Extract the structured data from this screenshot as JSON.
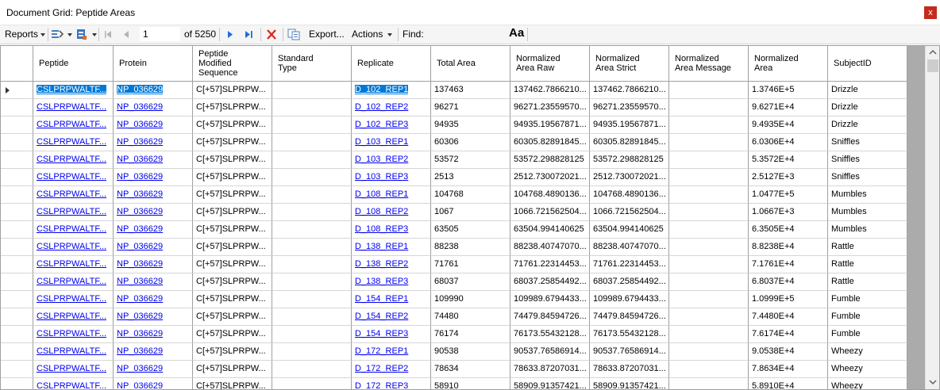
{
  "window": {
    "title": "Document Grid: Peptide Areas",
    "close_glyph": "x"
  },
  "toolbar": {
    "reports_label": "Reports",
    "position_value": "1",
    "of_label": "of 5250",
    "export_label": "Export...",
    "actions_label": "Actions",
    "find_label": "Find:",
    "find_value": "",
    "font_icon": "Aa"
  },
  "columns": [
    "Peptide",
    "Protein",
    "Peptide\nModified\nSequence",
    "Standard\nType",
    "Replicate",
    "Total Area",
    "Normalized\nArea Raw",
    "Normalized\nArea Strict",
    "Normalized\nArea Message",
    "Normalized\nArea",
    "SubjectID"
  ],
  "rows": [
    [
      "CSLPRPWALTF...",
      "NP_036629",
      "C[+57]SLPRPW...",
      "",
      "D_102_REP1",
      "137463",
      "137462.7866210...",
      "137462.7866210...",
      "",
      "1.3746E+5",
      "Drizzle"
    ],
    [
      "CSLPRPWALTF...",
      "NP_036629",
      "C[+57]SLPRPW...",
      "",
      "D_102_REP2",
      "96271",
      "96271.23559570...",
      "96271.23559570...",
      "",
      "9.6271E+4",
      "Drizzle"
    ],
    [
      "CSLPRPWALTF...",
      "NP_036629",
      "C[+57]SLPRPW...",
      "",
      "D_102_REP3",
      "94935",
      "94935.19567871...",
      "94935.19567871...",
      "",
      "9.4935E+4",
      "Drizzle"
    ],
    [
      "CSLPRPWALTF...",
      "NP_036629",
      "C[+57]SLPRPW...",
      "",
      "D_103_REP1",
      "60306",
      "60305.82891845...",
      "60305.82891845...",
      "",
      "6.0306E+4",
      "Sniffles"
    ],
    [
      "CSLPRPWALTF...",
      "NP_036629",
      "C[+57]SLPRPW...",
      "",
      "D_103_REP2",
      "53572",
      "53572.298828125",
      "53572.298828125",
      "",
      "5.3572E+4",
      "Sniffles"
    ],
    [
      "CSLPRPWALTF...",
      "NP_036629",
      "C[+57]SLPRPW...",
      "",
      "D_103_REP3",
      "2513",
      "2512.730072021...",
      "2512.730072021...",
      "",
      "2.5127E+3",
      "Sniffles"
    ],
    [
      "CSLPRPWALTF...",
      "NP_036629",
      "C[+57]SLPRPW...",
      "",
      "D_108_REP1",
      "104768",
      "104768.4890136...",
      "104768.4890136...",
      "",
      "1.0477E+5",
      "Mumbles"
    ],
    [
      "CSLPRPWALTF...",
      "NP_036629",
      "C[+57]SLPRPW...",
      "",
      "D_108_REP2",
      "1067",
      "1066.721562504...",
      "1066.721562504...",
      "",
      "1.0667E+3",
      "Mumbles"
    ],
    [
      "CSLPRPWALTF...",
      "NP_036629",
      "C[+57]SLPRPW...",
      "",
      "D_108_REP3",
      "63505",
      "63504.994140625",
      "63504.994140625",
      "",
      "6.3505E+4",
      "Mumbles"
    ],
    [
      "CSLPRPWALTF...",
      "NP_036629",
      "C[+57]SLPRPW...",
      "",
      "D_138_REP1",
      "88238",
      "88238.40747070...",
      "88238.40747070...",
      "",
      "8.8238E+4",
      "Rattle"
    ],
    [
      "CSLPRPWALTF...",
      "NP_036629",
      "C[+57]SLPRPW...",
      "",
      "D_138_REP2",
      "71761",
      "71761.22314453...",
      "71761.22314453...",
      "",
      "7.1761E+4",
      "Rattle"
    ],
    [
      "CSLPRPWALTF...",
      "NP_036629",
      "C[+57]SLPRPW...",
      "",
      "D_138_REP3",
      "68037",
      "68037.25854492...",
      "68037.25854492...",
      "",
      "6.8037E+4",
      "Rattle"
    ],
    [
      "CSLPRPWALTF...",
      "NP_036629",
      "C[+57]SLPRPW...",
      "",
      "D_154_REP1",
      "109990",
      "109989.6794433...",
      "109989.6794433...",
      "",
      "1.0999E+5",
      "Fumble"
    ],
    [
      "CSLPRPWALTF...",
      "NP_036629",
      "C[+57]SLPRPW...",
      "",
      "D_154_REP2",
      "74480",
      "74479.84594726...",
      "74479.84594726...",
      "",
      "7.4480E+4",
      "Fumble"
    ],
    [
      "CSLPRPWALTF...",
      "NP_036629",
      "C[+57]SLPRPW...",
      "",
      "D_154_REP3",
      "76174",
      "76173.55432128...",
      "76173.55432128...",
      "",
      "7.6174E+4",
      "Fumble"
    ],
    [
      "CSLPRPWALTF...",
      "NP_036629",
      "C[+57]SLPRPW...",
      "",
      "D_172_REP1",
      "90538",
      "90537.76586914...",
      "90537.76586914...",
      "",
      "9.0538E+4",
      "Wheezy"
    ],
    [
      "CSLPRPWALTF...",
      "NP_036629",
      "C[+57]SLPRPW...",
      "",
      "D_172_REP2",
      "78634",
      "78633.87207031...",
      "78633.87207031...",
      "",
      "7.8634E+4",
      "Wheezy"
    ],
    [
      "CSLPRPWALTF...",
      "NP_036629",
      "C[+57]SLPRPW...",
      "",
      "D_172_REP3",
      "58910",
      "58909.91357421...",
      "58909.91357421...",
      "",
      "5.8910E+4",
      "Wheezy"
    ]
  ],
  "selected_row": 0,
  "colors": {
    "link": "#0000ee",
    "selection": "#0078d7",
    "close_button": "#c42b1c",
    "nav_arrow": "#1e6fd9",
    "delete_x": "#e0241d"
  }
}
